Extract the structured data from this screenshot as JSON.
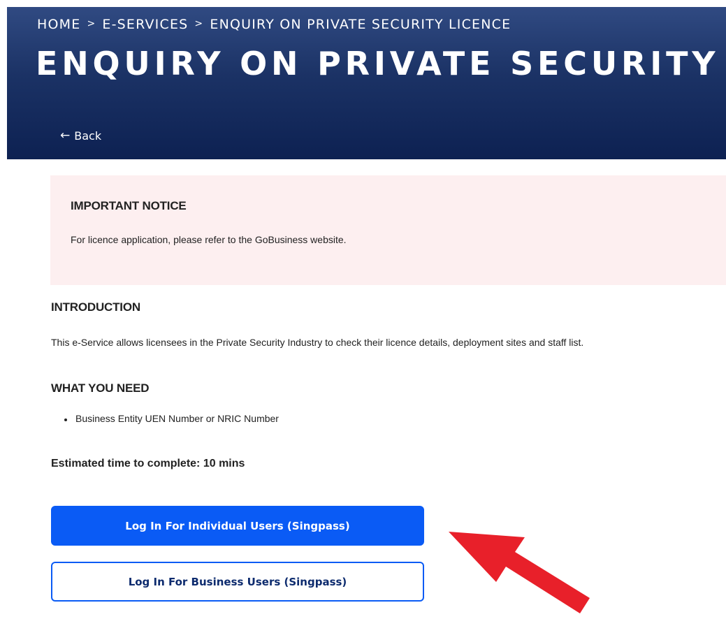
{
  "header": {
    "breadcrumb": [
      "HOME",
      "E-SERVICES",
      "ENQUIRY ON PRIVATE SECURITY LICENCE"
    ],
    "breadcrumb_separator": ">",
    "title": "ENQUIRY ON PRIVATE SECURITY LICENCE",
    "back_label": "Back",
    "back_icon": "arrow-left-icon",
    "colors": {
      "background": "#0d2152",
      "text": "#ffffff"
    }
  },
  "notice": {
    "title": "IMPORTANT NOTICE",
    "body": "For licence application, please refer to the GoBusiness website.",
    "background_color": "#fdeff0"
  },
  "introduction": {
    "heading": "INTRODUCTION",
    "text": "This e-Service allows licensees in the Private Security Industry to check their licence details, deployment sites and staff list."
  },
  "what_you_need": {
    "heading": "WHAT YOU NEED",
    "items": [
      "Business Entity UEN Number or NRIC Number"
    ]
  },
  "estimate": "Estimated time to complete: 10 mins",
  "buttons": {
    "individual_login": "Log In For Individual Users (Singpass)",
    "business_login": "Log In For Business Users (Singpass)",
    "primary_color": "#0a5bf5"
  },
  "annotation": {
    "icon": "red-arrow-icon",
    "color": "#e8202a"
  }
}
